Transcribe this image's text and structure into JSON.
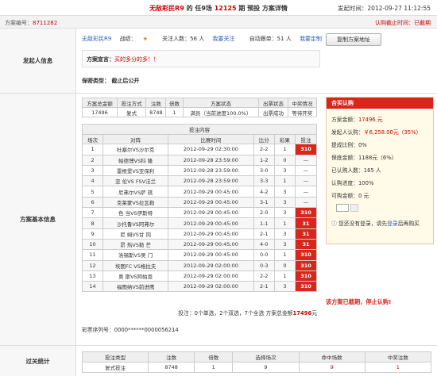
{
  "header": {
    "title_prefix": "无敌彩民R9",
    "title_mid": " 的 任9场 ",
    "title_issue": "12125",
    "title_suffix": " 期 预投 方案详情",
    "time": "发起时间：2012-09-27 11:12:55"
  },
  "subbar": {
    "id_label": "方案编号：",
    "id_value": "8711282",
    "deadline": "认购截止时间：已截期"
  },
  "initiator": {
    "section_label": "发起人信息",
    "user": "无敌彩民R9",
    "record_label": "战绩：",
    "followers": "关注人数：56 人",
    "follow_link": "我要关注",
    "auto_follow": "自动跟单：51 人",
    "custom_link": "我要定制",
    "copy_button": "复制方案地址",
    "declare_label": "方案宣言：",
    "declare_text": "买的多分的多！！",
    "privacy": "保密类型： 截止后公开"
  },
  "basic": {
    "section_label": "方案基本信息",
    "summary_table": {
      "headers": [
        "方案总金额",
        "投注方式",
        "注数",
        "倍数",
        "方案状态",
        "出票状态",
        "中奖情况"
      ],
      "row": [
        "17496",
        "复式",
        "8748",
        "1",
        "满员（当前进度100.0%）",
        "出票成功",
        "等待开奖"
      ]
    },
    "bet_table": {
      "caption": "投注内容",
      "headers": [
        "场次",
        "对阵",
        "比赛时间",
        "比分",
        "彩果",
        "投注"
      ],
      "rows": [
        [
          "1",
          "杜塞尔VS沙尔克",
          "2012-09-29 02:30:00",
          "2-2",
          "1",
          "310"
        ],
        [
          "2",
          "帕德博VS科 隆",
          "2012-09-28 23:59:00",
          "1-2",
          "0",
          "—"
        ],
        [
          "3",
          "雷根堡VS亚保利",
          "2012-09-28 23:59:00",
          "3-0",
          "3",
          "—"
        ],
        [
          "4",
          "亚 伦VS FSV法兰",
          "2012-09-28 23:59:00",
          "3-3",
          "1",
          "—"
        ],
        [
          "5",
          "尼弗尔VS萨 琪",
          "2012-09-29 00:45:00",
          "4-2",
          "3",
          "—"
        ],
        [
          "6",
          "克莱蒙VS拉瓦勒",
          "2012-09-29 00:45:00",
          "3-1",
          "3",
          "—"
        ],
        [
          "7",
          "色 当VS伊斯特",
          "2012-09-29 00:45:00",
          "2-0",
          "3",
          "310"
        ],
        [
          "8",
          "沙托鲁VS阿弗尔",
          "2012-09-29 00:45:00",
          "1-1",
          "1",
          "31"
        ],
        [
          "9",
          "尼 姆VS甘 冈",
          "2012-09-29 00:45:00",
          "2-1",
          "3",
          "31"
        ],
        [
          "10",
          "昂 热VS勒 芒",
          "2012-09-29 00:45:00",
          "4-0",
          "3",
          "31"
        ],
        [
          "11",
          "洛锡斯VS吴 门",
          "2012-09-29 00:45:00",
          "0-0",
          "1",
          "310"
        ],
        [
          "12",
          "埃图FC VS格拉夫",
          "2012-09-29 02:00:00",
          "0-3",
          "0",
          "310"
        ],
        [
          "13",
          "奥 斯VS阿帕恩",
          "2012-09-29 02:00:00",
          "2-2",
          "1",
          "310"
        ],
        [
          "14",
          "福图纳VS前进鹰",
          "2012-09-29 02:00:00",
          "2-1",
          "3",
          "310"
        ]
      ],
      "summary_prefix": "投注：0个单选，2个双选，7个全选 方案总金额",
      "summary_amount": "17496",
      "summary_suffix": "元",
      "serial": "彩票序列号：0000******0000056214"
    },
    "panel": {
      "title": "合买认购",
      "total_label": "方案金额：",
      "total_value": "17496 元",
      "share_label": "发起人认购：",
      "share_value": "￥6,258.00元（35%）",
      "commission": "提成比例：0%",
      "guarantee": "保底金额：1188元（6%）",
      "bought": "已认购人数：165 人",
      "progress": "认购进度：100%",
      "available": "可购金额：0 元",
      "notice_prefix": "您还没有登录，请先",
      "notice_link": "登录",
      "notice_suffix": "后再购买",
      "ended": "该方案已截期，停止认购!"
    }
  },
  "stats": {
    "section_label": "过关统计",
    "headers": [
      "投注类型",
      "注数",
      "倍数",
      "选择场次",
      "命中场数",
      "中奖注数"
    ],
    "row": [
      "复式投注",
      "8748",
      "1",
      "9",
      "9",
      "1"
    ]
  }
}
